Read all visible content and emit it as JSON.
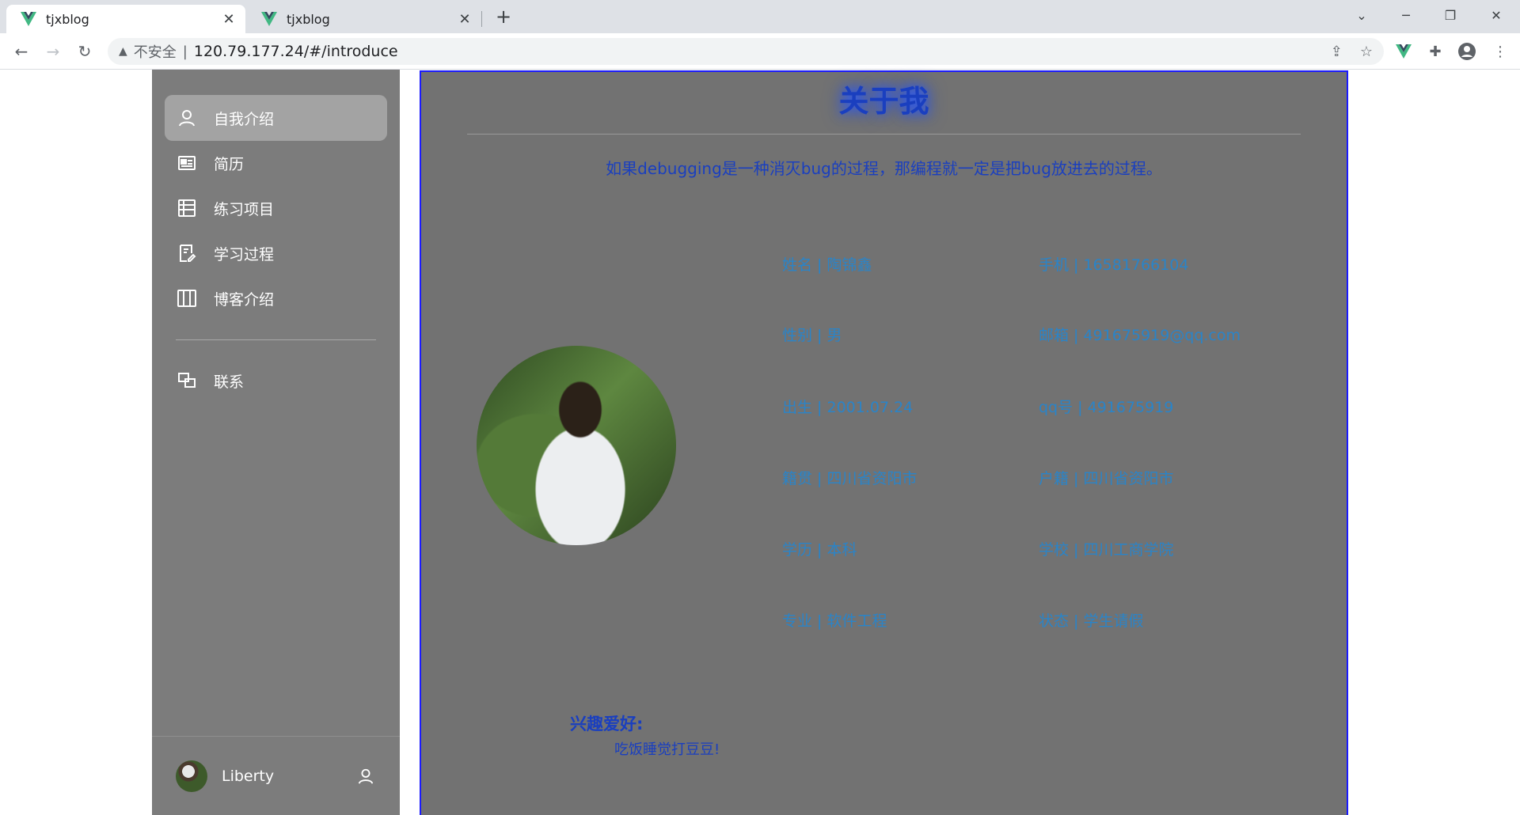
{
  "browser": {
    "tabs": [
      {
        "title": "tjxblog"
      },
      {
        "title": "tjxblog"
      }
    ],
    "address": {
      "security_label": "不安全",
      "url": "120.79.177.24/#/introduce"
    }
  },
  "sidebar": {
    "items": [
      {
        "label": "自我介绍",
        "icon": "user-icon",
        "active": true
      },
      {
        "label": "简历",
        "icon": "id-card-icon",
        "active": false
      },
      {
        "label": "练习项目",
        "icon": "list-icon",
        "active": false
      },
      {
        "label": "学习过程",
        "icon": "notes-icon",
        "active": false
      },
      {
        "label": "博客介绍",
        "icon": "columns-icon",
        "active": false
      },
      {
        "label": "联系",
        "icon": "contact-icon",
        "active": false
      }
    ],
    "user": {
      "name": "Liberty"
    }
  },
  "main": {
    "title": "关于我",
    "motto": "如果debugging是一种消灭bug的过程，那编程就一定是把bug放进去的过程。",
    "info": [
      {
        "left": "姓名 | 陶锦鑫",
        "right": "手机 | 16581766104"
      },
      {
        "left": "性别 | 男",
        "right": "邮箱 | 491675919@qq.com"
      },
      {
        "left": "出生 | 2001.07.24",
        "right": "qq号 | 491675919"
      },
      {
        "left": "籍贯 | 四川省资阳市",
        "right": "户籍 | 四川省资阳市"
      },
      {
        "left": "学历 | 本科",
        "right": "学校 | 四川工商学院"
      },
      {
        "left": "专业 | 软件工程",
        "right": "状态 | 学生请假"
      }
    ],
    "hobby_title": "兴趣爱好:",
    "hobby_value": "吃饭睡觉打豆豆!"
  },
  "colors": {
    "sidebar_bg": "#7c7c7c",
    "content_bg": "#727272",
    "title_color": "#1a3fbf",
    "info_color": "#2a84c8",
    "content_border": "#1a1aff"
  }
}
